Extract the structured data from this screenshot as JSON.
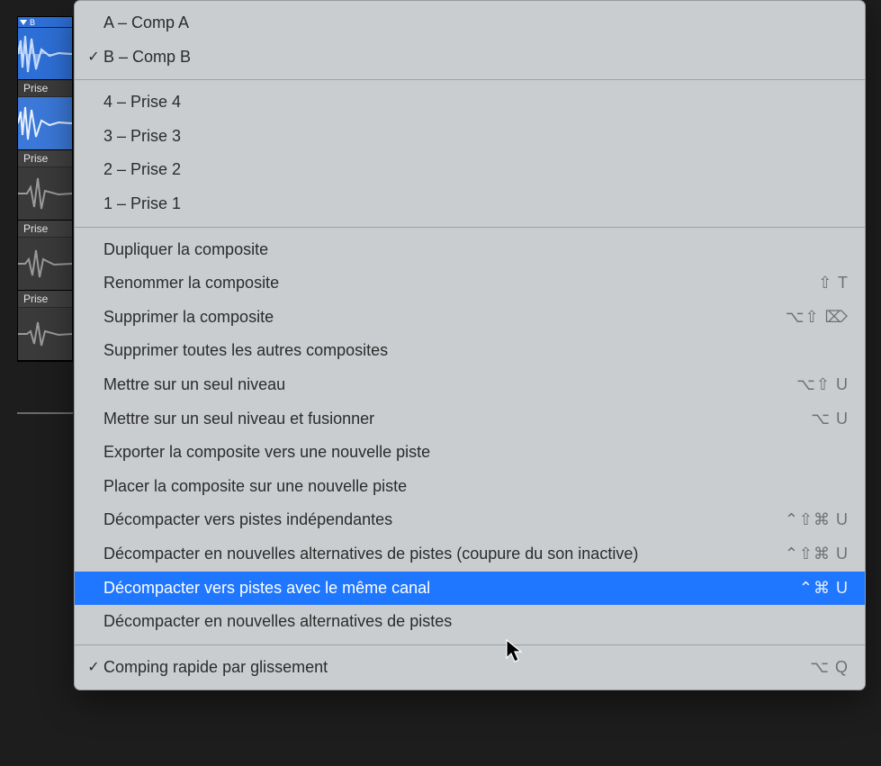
{
  "track_header_name": "B",
  "takes": [
    {
      "label": "Prise",
      "selected": true
    },
    {
      "label": "Prise",
      "selected": false
    },
    {
      "label": "Prise",
      "selected": false
    },
    {
      "label": "Prise",
      "selected": false
    }
  ],
  "menu": {
    "comps": [
      {
        "label": "A – Comp A",
        "checked": false
      },
      {
        "label": "B – Comp B",
        "checked": true
      }
    ],
    "takes_list": [
      {
        "label": "4 – Prise 4"
      },
      {
        "label": "3 – Prise 3"
      },
      {
        "label": "2 – Prise 2"
      },
      {
        "label": "1 – Prise 1"
      }
    ],
    "actions": [
      {
        "label": "Dupliquer la composite",
        "shortcut": ""
      },
      {
        "label": "Renommer la composite",
        "shortcut": "⇧ T"
      },
      {
        "label": "Supprimer la composite",
        "shortcut": "⌥⇧ ⌦"
      },
      {
        "label": "Supprimer toutes les autres composites",
        "shortcut": ""
      },
      {
        "label": "Mettre sur un seul niveau",
        "shortcut": "⌥⇧ U"
      },
      {
        "label": "Mettre sur un seul niveau et fusionner",
        "shortcut": "⌥ U"
      },
      {
        "label": "Exporter la composite vers une nouvelle piste",
        "shortcut": ""
      },
      {
        "label": "Placer la composite sur une nouvelle piste",
        "shortcut": ""
      },
      {
        "label": "Décompacter vers pistes indépendantes",
        "shortcut": "⌃⇧⌘ U"
      },
      {
        "label": "Décompacter en nouvelles alternatives de pistes (coupure du son inactive)",
        "shortcut": "⌃⇧⌘ U"
      },
      {
        "label": "Décompacter vers pistes avec le même canal",
        "shortcut": "⌃⌘ U",
        "highlight": true
      },
      {
        "label": "Décompacter en nouvelles alternatives de pistes",
        "shortcut": ""
      }
    ],
    "footer": {
      "label": "Comping rapide par glissement",
      "shortcut": "⌥ Q",
      "checked": true
    }
  }
}
